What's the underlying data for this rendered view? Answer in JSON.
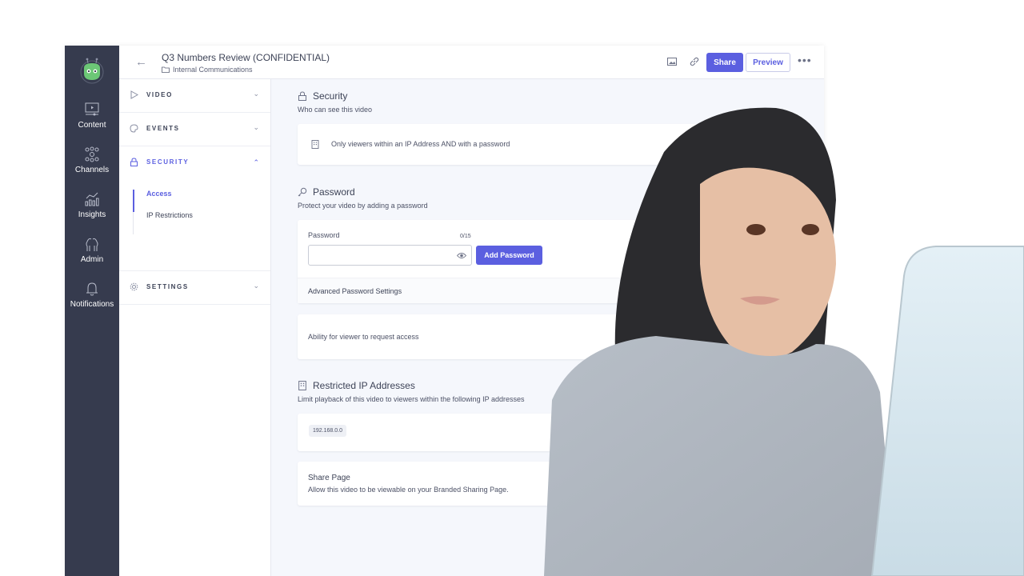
{
  "header": {
    "title": "Q3 Numbers Review (CONFIDENTIAL)",
    "folder": "Internal Communications",
    "share_label": "Share",
    "preview_label": "Preview",
    "more_label": "•••"
  },
  "rail": {
    "items": [
      {
        "label": "Content",
        "icon": "video-player-icon"
      },
      {
        "label": "Channels",
        "icon": "network-icon"
      },
      {
        "label": "Insights",
        "icon": "chart-icon"
      },
      {
        "label": "Admin",
        "icon": "users-icon"
      },
      {
        "label": "Notifications",
        "icon": "bell-icon"
      }
    ]
  },
  "nav": {
    "sections": [
      {
        "label": "VIDEO",
        "icon": "play-icon",
        "expanded": false
      },
      {
        "label": "EVENTS",
        "icon": "palette-icon",
        "expanded": false
      },
      {
        "label": "SECURITY",
        "icon": "lock-icon",
        "expanded": true
      },
      {
        "label": "SETTINGS",
        "icon": "gear-icon",
        "expanded": false
      }
    ],
    "security_items": [
      "Access",
      "IP Restrictions"
    ],
    "active_item": "Access"
  },
  "main": {
    "security": {
      "title": "Security",
      "subtitle": "Who can see this video",
      "access_option": "Only viewers within an IP Address AND with a password"
    },
    "password": {
      "title": "Password",
      "subtitle": "Protect your video by adding a password",
      "field_label": "Password",
      "counter": "0/15",
      "value": "",
      "add_label": "Add Password",
      "advanced_label": "Advanced Password Settings",
      "request_access_label": "Ability for viewer to request access"
    },
    "ip": {
      "title": "Restricted IP Addresses",
      "subtitle": "Limit playback of this video to viewers within the following IP addresses",
      "addresses": [
        "192.168.0.0"
      ]
    },
    "share_page": {
      "title": "Share Page",
      "description": "Allow this video to be viewable on your Branded Sharing Page."
    }
  },
  "colors": {
    "accent": "#5b5fe0",
    "rail": "#363b4e",
    "logo": "#6cc776"
  }
}
